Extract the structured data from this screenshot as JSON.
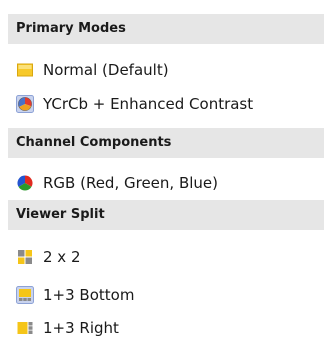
{
  "sections": [
    {
      "header": "Primary Modes",
      "items": [
        {
          "label": "Normal (Default)",
          "icon": "normal-mode-icon"
        },
        {
          "label": "YCrCb + Enhanced Contrast",
          "icon": "ycrcb-mode-icon"
        }
      ]
    },
    {
      "header": "Channel Components",
      "items": [
        {
          "label": "RGB  (Red, Green, Blue)",
          "icon": "rgb-channels-icon"
        }
      ]
    },
    {
      "header": "Viewer Split",
      "items": [
        {
          "label": "2 x 2",
          "icon": "grid-2x2-icon"
        },
        {
          "label": "1+3 Bottom",
          "icon": "split-1-3-bottom-icon"
        },
        {
          "label": "1+3 Right",
          "icon": "split-1-3-right-icon"
        }
      ]
    }
  ],
  "colors": {
    "header_background": "#e6e6e6",
    "accent_yellow": "#f5c518",
    "icon_border_blue": "#8da2d6"
  }
}
